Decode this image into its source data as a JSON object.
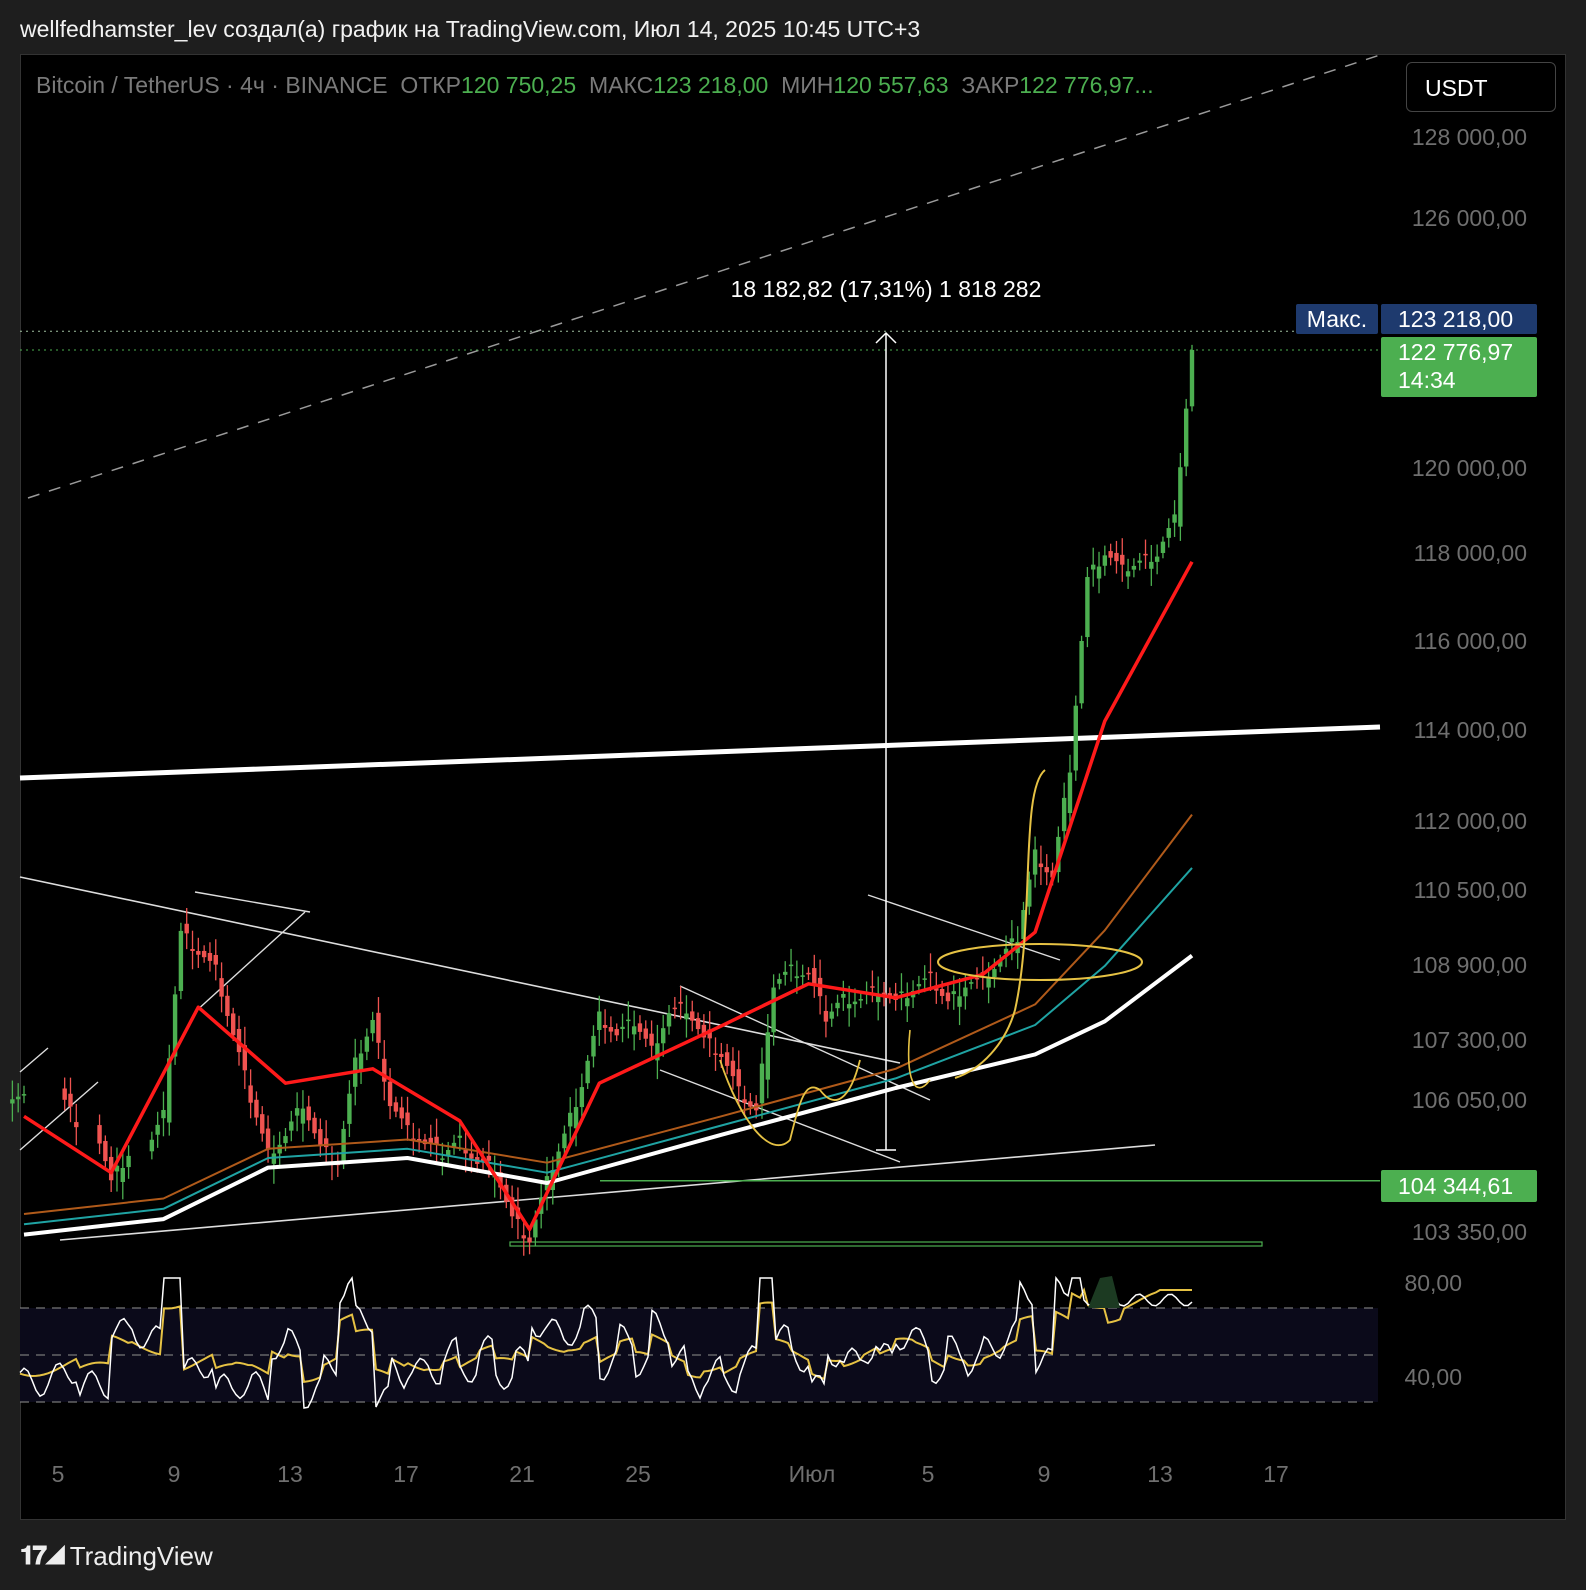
{
  "header": {
    "caption": "wellfedhamster_lev создал(а) график на TradingView.com, Июл 14, 2025 10:45 UTC+3"
  },
  "legend": {
    "symbol": "Bitcoin / TetherUS · 4ч · BINANCE",
    "open_label": "ОТКР",
    "open": "120 750,25",
    "high_label": "МАКС",
    "high": "123 218,00",
    "low_label": "МИН",
    "low": "120 557,63",
    "close_label": "ЗАКР",
    "close": "122 776,97..."
  },
  "currency_button": "USDT",
  "measure_label": "18 182,82 (17,31%) 1 818 282",
  "price_tags": {
    "max_label": "Макс.",
    "max_value": "123 218,00",
    "current_value": "122 776,97",
    "countdown": "14:34",
    "level_value": "104 344,61"
  },
  "footer": {
    "brand": "TradingView"
  },
  "colors": {
    "up": "#4caf50",
    "down": "#ef5350",
    "ema_fast": "#ff1a1a",
    "ema_mid": "#b05a1a",
    "ema_slow": "#1fa3a3",
    "ma_long": "#ffffff",
    "rsi": "#ffffff",
    "rsi_ma": "#e6c244",
    "max_tag": "#1e3a6e",
    "price_tag": "#4caf50"
  },
  "chart_data": {
    "type": "candlestick",
    "timeframe": "4h",
    "y_ticks": [
      "128 000,00",
      "126 000,00",
      "120 000,00",
      "118 000,00",
      "116 000,00",
      "114 000,00",
      "112 000,00",
      "110 500,00",
      "108 900,00",
      "107 300,00",
      "106 050,00",
      "103 350,00"
    ],
    "x_ticks": [
      "5",
      "9",
      "13",
      "17",
      "21",
      "25",
      "Июл",
      "5",
      "9",
      "13",
      "17"
    ],
    "close_path": [
      [
        0,
        106200
      ],
      [
        3,
        105600
      ],
      [
        5,
        104300
      ],
      [
        6,
        104900
      ],
      [
        8,
        105700
      ],
      [
        9,
        109600
      ],
      [
        10,
        109200
      ],
      [
        11,
        108800
      ],
      [
        12,
        107400
      ],
      [
        13,
        106100
      ],
      [
        14,
        104900
      ],
      [
        15,
        105300
      ],
      [
        16,
        106000
      ],
      [
        17,
        105000
      ],
      [
        18,
        104700
      ],
      [
        19,
        106800
      ],
      [
        20,
        107700
      ],
      [
        21,
        106000
      ],
      [
        22,
        105400
      ],
      [
        23,
        105100
      ],
      [
        24,
        104900
      ],
      [
        25,
        105200
      ],
      [
        26,
        104700
      ],
      [
        27,
        104600
      ],
      [
        28,
        103600
      ],
      [
        29,
        103200
      ],
      [
        30,
        104300
      ],
      [
        31,
        105300
      ],
      [
        32,
        106400
      ],
      [
        33,
        107800
      ],
      [
        34,
        107400
      ],
      [
        35,
        107700
      ],
      [
        36,
        107100
      ],
      [
        37,
        107900
      ],
      [
        38,
        108000
      ],
      [
        39,
        107300
      ],
      [
        40,
        107000
      ],
      [
        41,
        106200
      ],
      [
        42,
        105800
      ],
      [
        43,
        108500
      ],
      [
        44,
        108800
      ],
      [
        45,
        108700
      ],
      [
        46,
        107800
      ],
      [
        47,
        108200
      ],
      [
        48,
        108200
      ],
      [
        49,
        108400
      ],
      [
        50,
        108100
      ],
      [
        51,
        108400
      ],
      [
        52,
        108600
      ],
      [
        53,
        108100
      ],
      [
        54,
        108500
      ],
      [
        55,
        108600
      ],
      [
        56,
        109000
      ],
      [
        57,
        109500
      ],
      [
        58,
        111300
      ],
      [
        59,
        110800
      ],
      [
        60,
        113200
      ],
      [
        61,
        117400
      ],
      [
        62,
        118000
      ],
      [
        63,
        117600
      ],
      [
        64,
        117800
      ],
      [
        65,
        118000
      ],
      [
        66,
        118800
      ],
      [
        67,
        122777
      ]
    ],
    "indicators": {
      "ema_fast": [
        [
          0,
          105700
        ],
        [
          5,
          104500
        ],
        [
          10,
          108000
        ],
        [
          15,
          106400
        ],
        [
          20,
          106700
        ],
        [
          25,
          105600
        ],
        [
          29,
          103400
        ],
        [
          33,
          106400
        ],
        [
          40,
          107600
        ],
        [
          45,
          108500
        ],
        [
          50,
          108200
        ],
        [
          55,
          108700
        ],
        [
          58,
          109600
        ],
        [
          62,
          114200
        ],
        [
          67,
          117800
        ]
      ],
      "ma_long": [
        [
          0,
          103300
        ],
        [
          8,
          103600
        ],
        [
          14,
          104600
        ],
        [
          22,
          104800
        ],
        [
          30,
          104300
        ],
        [
          40,
          105300
        ],
        [
          50,
          106300
        ],
        [
          58,
          107000
        ],
        [
          62,
          107700
        ],
        [
          67,
          109100
        ]
      ],
      "horizontal_level": 104344.61,
      "max_level": 123218,
      "rsi_levels": [
        80,
        40
      ]
    },
    "annotations": [
      "Макс.",
      "18 182,82 (17,31%) 1 818 282"
    ]
  }
}
